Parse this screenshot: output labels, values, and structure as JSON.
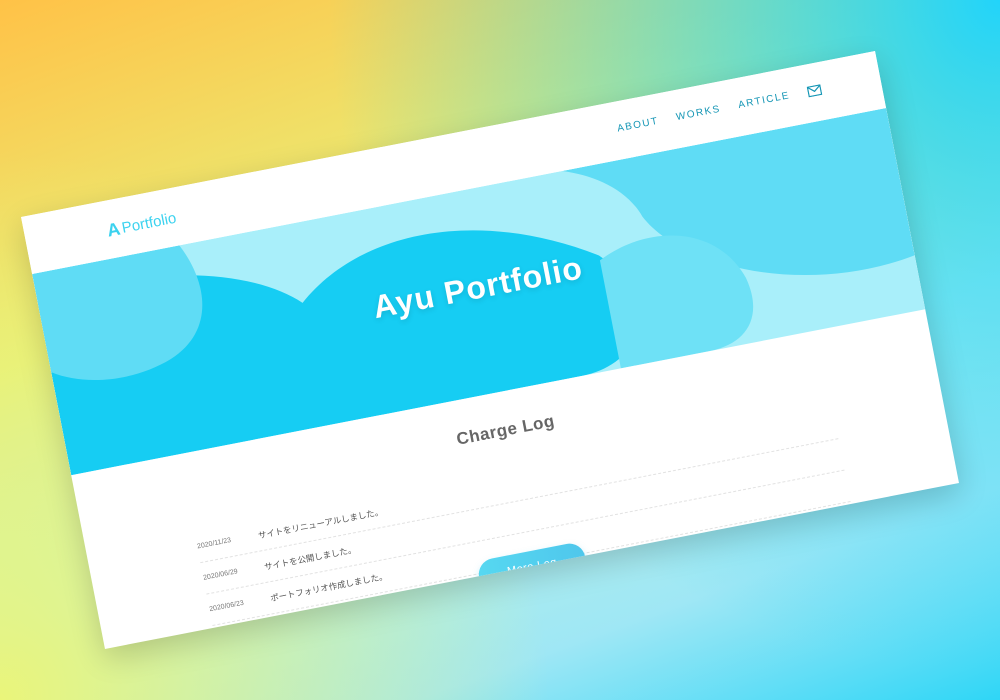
{
  "header": {
    "logo_mark": "A",
    "logo_text": "Portfolio",
    "nav": {
      "about": "ABOUT",
      "works": "WORKS",
      "article": "ARTICLE"
    },
    "mail_icon": "envelope-icon"
  },
  "hero": {
    "title": "Ayu Portfolio"
  },
  "log": {
    "title": "Charge Log",
    "entries": [
      {
        "date": "2020/11/23",
        "text": "サイトをリニューアルしました。"
      },
      {
        "date": "2020/06/29",
        "text": "サイトを公開しました。"
      },
      {
        "date": "2020/06/23",
        "text": "ポートフォリオ作成しました。"
      }
    ],
    "more_label": "More Log"
  },
  "colors": {
    "accent": "#3bd2ef",
    "nav": "#1596b5",
    "hero_light": "#a9effa",
    "hero_mid": "#5fdcf5",
    "hero_deep": "#16cdf3"
  }
}
